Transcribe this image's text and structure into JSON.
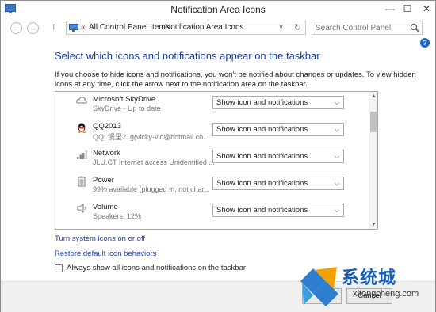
{
  "window": {
    "title": "Notification Area Icons",
    "minimize": "—",
    "maximize": "☐",
    "close": "✕"
  },
  "nav": {
    "back": "←",
    "forward": "→",
    "up": "↑",
    "chevron": "«",
    "breadcrumb": [
      "All Control Panel Items",
      "Notification Area Icons"
    ],
    "separator": "›",
    "dropdown": "˅",
    "refresh": "↻",
    "search_placeholder": "Search Control Panel"
  },
  "help": "?",
  "main": {
    "heading": "Select which icons and notifications appear on the taskbar",
    "description": "If you choose to hide icons and notifications, you won't be notified about changes or updates. To view hidden icons at any time, click the arrow next to the notification area on the taskbar."
  },
  "icons_list": [
    {
      "name": "Microsoft SkyDrive",
      "status": "SkyDrive - Up to date",
      "behavior": "Show icon and notifications",
      "icon": "cloud-icon"
    },
    {
      "name": "QQ2013",
      "status": "QQ: 漫里21g(vicky-vic@hotmail.co...",
      "behavior": "Show icon and notifications",
      "icon": "penguin-icon"
    },
    {
      "name": "Network",
      "status": "JLU.CT Internet access  Unidentified ...",
      "behavior": "Show icon and notifications",
      "icon": "network-icon"
    },
    {
      "name": "Power",
      "status": "99% available (plugged in, not char...",
      "behavior": "Show icon and notifications",
      "icon": "battery-icon"
    },
    {
      "name": "Volume",
      "status": "Speakers: 12%",
      "behavior": "Show icon and notifications",
      "icon": "speaker-icon"
    }
  ],
  "scroll": {
    "up": "▲",
    "down": "▼"
  },
  "links": {
    "system_icons": "Turn system icons on or off",
    "restore": "Restore default icon behaviors"
  },
  "always_show": {
    "label": "Always show all icons and notifications on the taskbar",
    "checked": false
  },
  "buttons": {
    "ok": "OK",
    "cancel": "Cancel"
  },
  "watermark": {
    "brand": "系统城",
    "url": "xitongcheng.com"
  },
  "colors": {
    "link": "#1f3f9a",
    "accent": "#1a5fb4",
    "help": "#1e66c8"
  }
}
